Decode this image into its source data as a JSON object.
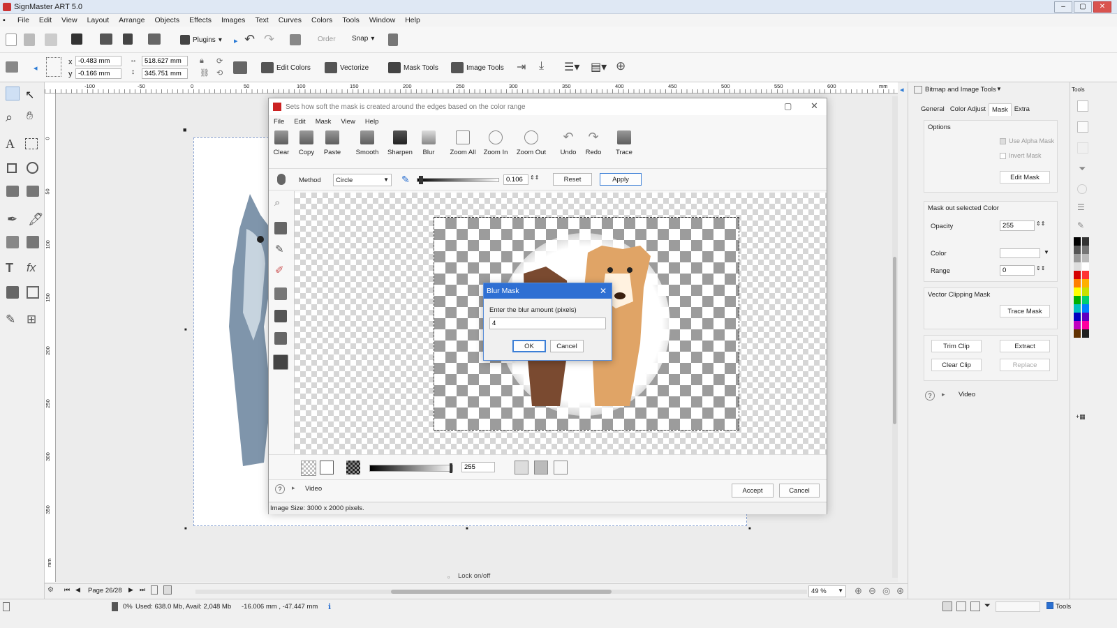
{
  "app": {
    "title": "SignMaster ART 5.0"
  },
  "menu": [
    "File",
    "Edit",
    "View",
    "Layout",
    "Arrange",
    "Objects",
    "Effects",
    "Images",
    "Text",
    "Curves",
    "Colors",
    "Tools",
    "Window",
    "Help"
  ],
  "toolbar1": {
    "plugins": "Plugins",
    "order": "Order",
    "snap": "Snap"
  },
  "toolbar2": {
    "x_label": "x",
    "y_label": "y",
    "x_value": "-0.483 mm",
    "y_value": "-0.166 mm",
    "w_value": "518.627 mm",
    "h_value": "345.751 mm",
    "edit_colors": "Edit Colors",
    "vectorize": "Vectorize",
    "mask_tools": "Mask Tools",
    "image_tools": "Image Tools"
  },
  "ruler_h": [
    "-100",
    "-50",
    "0",
    "50",
    "100",
    "150",
    "200",
    "250",
    "300",
    "350",
    "400",
    "450",
    "500",
    "550",
    "600",
    "mm"
  ],
  "ruler_v": [
    "0",
    "50",
    "100",
    "150",
    "200",
    "250",
    "300",
    "350",
    "mm"
  ],
  "mask_dialog": {
    "title": "Sets how soft the mask is created around the edges based on the color range",
    "menu": [
      "File",
      "Edit",
      "Mask",
      "View",
      "Help"
    ],
    "tools": [
      "Clear",
      "Copy",
      "Paste",
      "Smooth",
      "Sharpen",
      "Blur",
      "Zoom All",
      "Zoom In",
      "Zoom Out",
      "Undo",
      "Redo",
      "Trace"
    ],
    "method_label": "Method",
    "method_value": "Circle",
    "softness_value": "0.106",
    "reset": "Reset",
    "apply": "Apply",
    "opacity_value": "255",
    "video": "Video",
    "accept": "Accept",
    "cancel": "Cancel",
    "status": "Image Size: 3000 x 2000 pixels."
  },
  "blur_dialog": {
    "title": "Blur Mask",
    "prompt": "Enter the blur amount (pixels)",
    "value": "4",
    "ok": "OK",
    "cancel": "Cancel"
  },
  "right_panel": {
    "header": "Bitmap and Image Tools",
    "tabs": [
      "General",
      "Color Adjust",
      "Mask",
      "Extra"
    ],
    "options_title": "Options",
    "use_alpha_mask": "Use Alpha Mask",
    "invert_mask": "Invert Mask",
    "edit_mask": "Edit Mask",
    "mask_out_title": "Mask out selected Color",
    "opacity_label": "Opacity",
    "opacity_value": "255",
    "color_label": "Color",
    "range_label": "Range",
    "range_value": "0",
    "vector_title": "Vector Clipping Mask",
    "trace_mask": "Trace Mask",
    "trim_clip": "Trim Clip",
    "extract": "Extract",
    "clear_clip": "Clear Clip",
    "replace": "Replace",
    "video": "Video"
  },
  "palette": {
    "header": "Tools",
    "colors": [
      "#000000",
      "#333333",
      "#555555",
      "#777777",
      "#999999",
      "#bbbbbb",
      "#dddddd",
      "#ffffff",
      "#d40000",
      "#ff3333",
      "#ff7f00",
      "#ffb000",
      "#ffff00",
      "#c8e000",
      "#00b000",
      "#00d070",
      "#00c0c0",
      "#0080ff",
      "#0000c0",
      "#6000c0",
      "#c000c0",
      "#ff00a0",
      "#603000",
      "#202020"
    ]
  },
  "bottom": {
    "page": "Page 26/28",
    "lock": "Lock on/off",
    "zoom": "49 %"
  },
  "status": {
    "memory": "Used: 638.0 Mb, Avail: 2,048 Mb",
    "progress": "0%",
    "coords": "-16.006 mm , -47.447 mm",
    "tools": "Tools"
  }
}
